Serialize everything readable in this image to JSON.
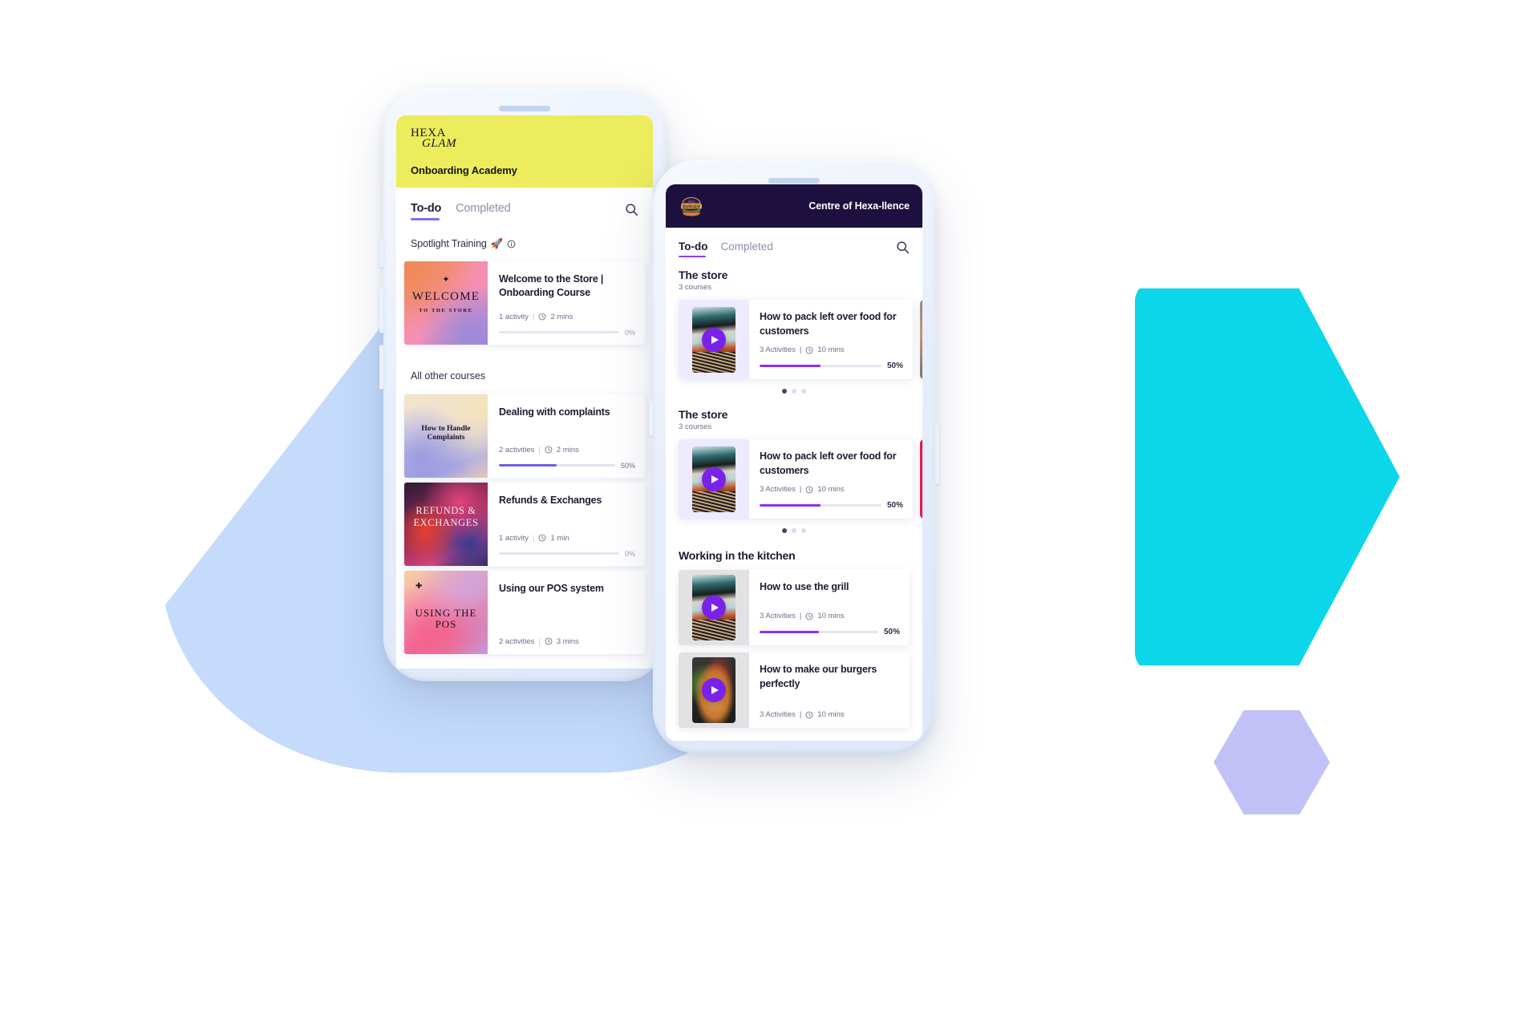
{
  "colors": {
    "hexaglam_yellow": "#ECEC5D",
    "hexaburger_navy": "#1D103F",
    "accent_purple": "#7B22EA",
    "tab_underline_left": "#7B6EF6",
    "progress_purple": "#6A5DF0",
    "bg_blue_blob": "#C4DBFB",
    "bg_cyan_hex": "#0BD6EA",
    "bg_purple_hex": "#C2C1F7",
    "phone_frame": "#E7EEFB"
  },
  "left_phone": {
    "brand": {
      "line1": "HEXA",
      "line2": "GLAM"
    },
    "header_title": "Onboarding Academy",
    "tabs": [
      {
        "label": "To-do",
        "active": true
      },
      {
        "label": "Completed",
        "active": false
      }
    ],
    "search_icon": "search-icon",
    "sections": [
      {
        "title": "Spotlight Training",
        "emoji": "🚀",
        "info_icon": "info-icon",
        "courses": [
          {
            "title": "Welcome to the Store | Onboarding Course",
            "activities": "1 activity",
            "duration": "2 mins",
            "progress": 0,
            "progress_label": "0%",
            "thumb_caption": "WELCOME",
            "thumb_subcaption": "TO THE STORE"
          }
        ]
      },
      {
        "title": "All other courses",
        "courses": [
          {
            "title": "Dealing with complaints",
            "activities": "2 activities",
            "duration": "2 mins",
            "progress": 50,
            "progress_label": "50%",
            "thumb_caption": "How to Handle Complaints"
          },
          {
            "title": "Refunds & Exchanges",
            "activities": "1 activity",
            "duration": "1 min",
            "progress": 0,
            "progress_label": "0%",
            "thumb_caption": "REFUNDS & EXCHANGES"
          },
          {
            "title": "Using our POS system",
            "activities": "2 activities",
            "duration": "3 mins",
            "progress": null,
            "progress_label": "",
            "thumb_caption": "USING THE POS"
          }
        ]
      }
    ]
  },
  "right_phone": {
    "brand": {
      "line1": "HEXA",
      "line2": "BURGER"
    },
    "header_title": "Centre of Hexa-llence",
    "tabs": [
      {
        "label": "To-do",
        "active": true
      },
      {
        "label": "Completed",
        "active": false
      }
    ],
    "search_icon": "search-icon",
    "groups": [
      {
        "title": "The store",
        "subtitle": "3 courses",
        "layout": "carousel",
        "dots": {
          "count": 3,
          "active_index": 0
        },
        "courses": [
          {
            "title": "How to pack left over food for customers",
            "activities": "3 Activities",
            "duration": "10 mins",
            "progress": 50,
            "progress_label": "50%",
            "thumb": "grill-video"
          }
        ]
      },
      {
        "title": "The store",
        "subtitle": "3 courses",
        "layout": "carousel",
        "dots": {
          "count": 3,
          "active_index": 0
        },
        "courses": [
          {
            "title": "How to pack left over food for customers",
            "activities": "3 Activities",
            "duration": "10 mins",
            "progress": 50,
            "progress_label": "50%",
            "thumb": "grill-video"
          }
        ]
      },
      {
        "title": "Working in the kitchen",
        "subtitle": "",
        "layout": "list",
        "courses": [
          {
            "title": "How to use the grill",
            "activities": "3 Activities",
            "duration": "10 mins",
            "progress": 50,
            "progress_label": "50%",
            "thumb": "grill-video"
          },
          {
            "title": "How to make our burgers perfectly",
            "activities": "3 Activities",
            "duration": "10 mins",
            "progress": null,
            "progress_label": "",
            "thumb": "burger-video"
          }
        ]
      }
    ]
  }
}
